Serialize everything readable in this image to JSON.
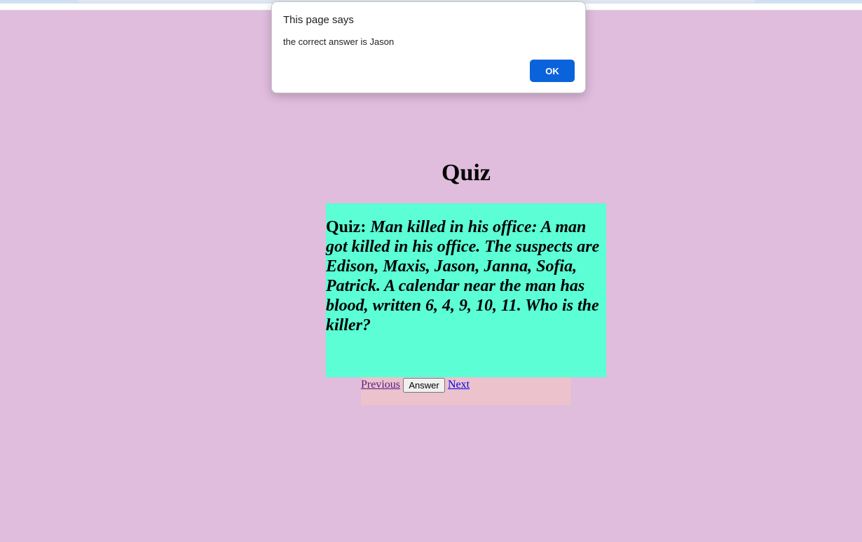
{
  "dialog": {
    "title": "This page says",
    "message": "the correct answer is Jason",
    "ok_label": "OK"
  },
  "page": {
    "heading": "Quiz"
  },
  "quiz": {
    "prefix": "Quiz: ",
    "question": "Man killed in his office: A man got killed in his office. The suspects are Edison, Maxis, Jason, Janna, Sofia, Patrick. A calendar near the man has blood, written 6, 4, 9, 10, 11. Who is the killer?"
  },
  "nav": {
    "previous_label": "Previous",
    "answer_label": "Answer",
    "next_label": "Next"
  },
  "colors": {
    "page_background": "#e0bcdd",
    "quiz_background": "#5bfed5",
    "nav_background": "#ecc2cc",
    "dialog_button": "#0b63dc"
  }
}
